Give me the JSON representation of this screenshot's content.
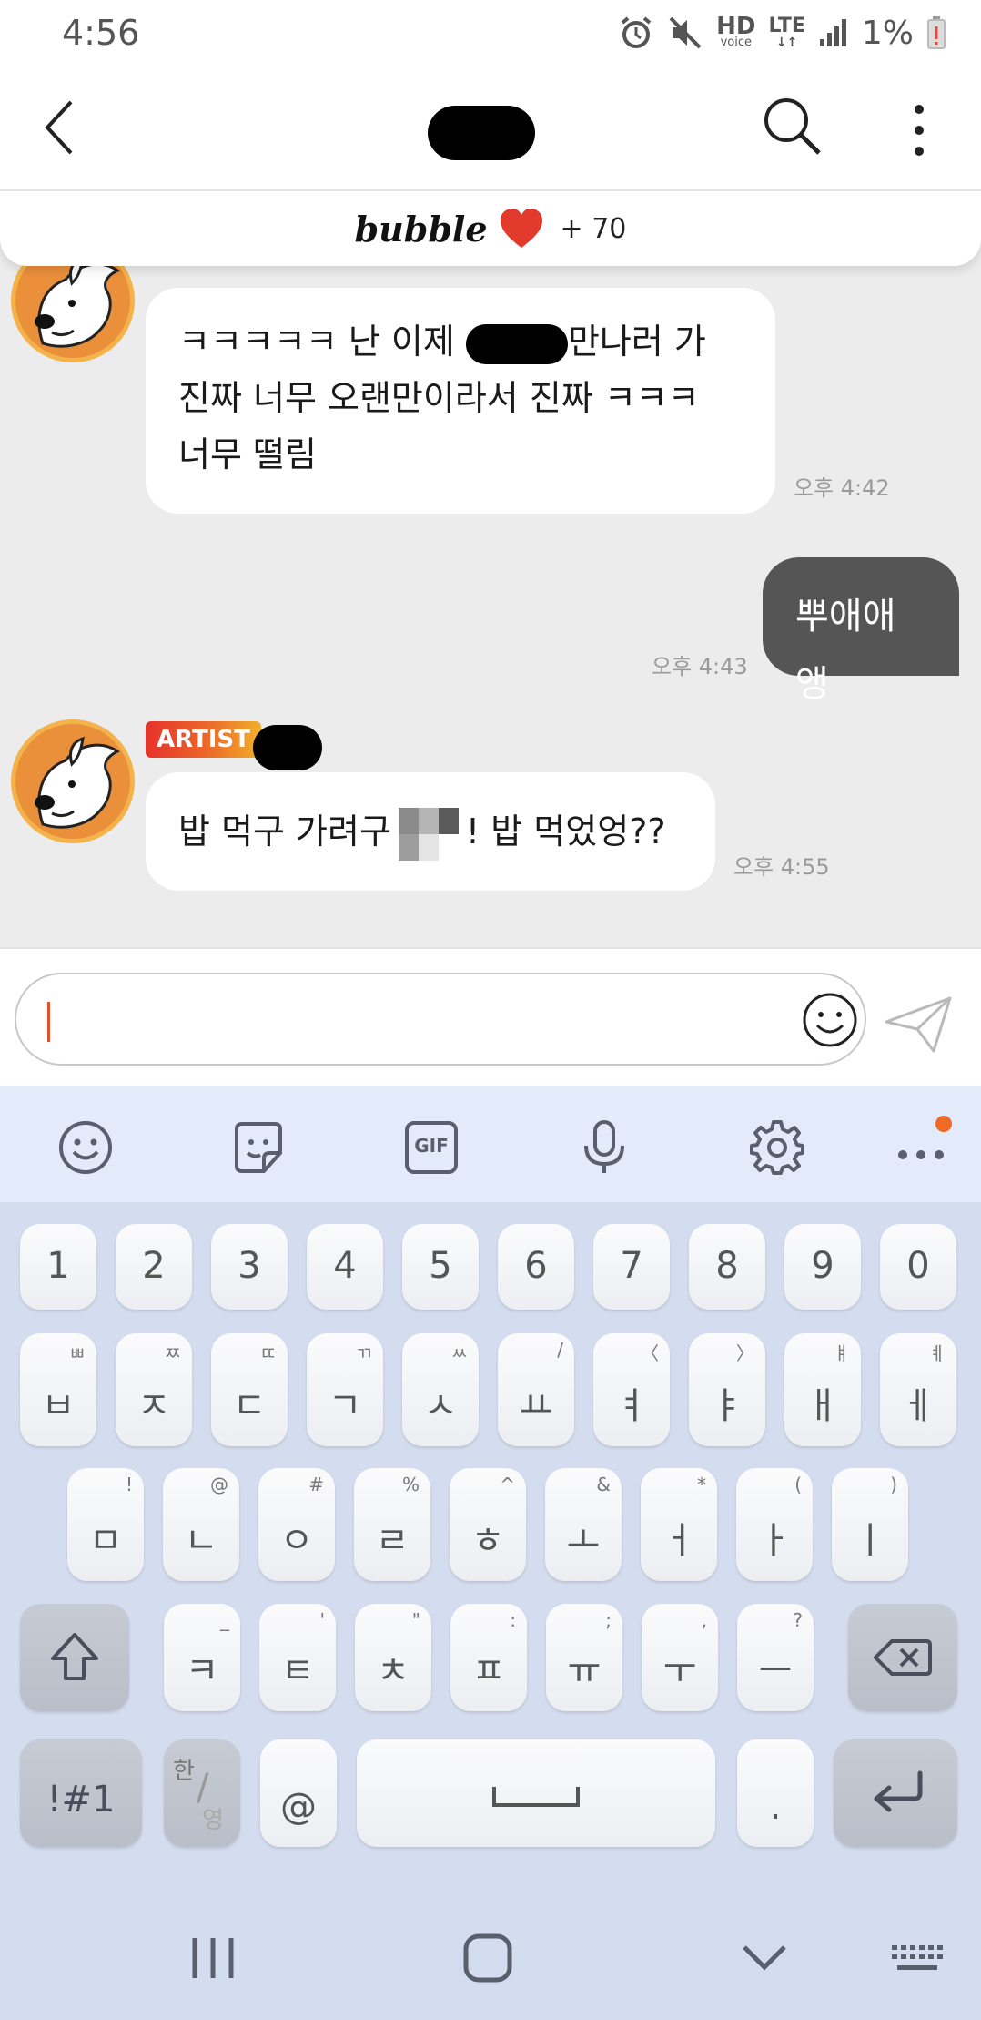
{
  "status_bar": {
    "time": "4:56",
    "hd_label": "HD",
    "hd_sub": "voice",
    "lte_label": "LTE",
    "battery": "1%"
  },
  "header": {
    "back_icon": "chevron-left-icon",
    "search_icon": "search-icon",
    "more_icon": "more-vertical-icon"
  },
  "banner": {
    "logo": "bubble",
    "heart_color": "#e23a2c",
    "plus": "+ 70"
  },
  "messages": [
    {
      "sender": "artist",
      "lines": [
        "ㅋㅋㅋㅋㅋ 난 이제",
        "만나러 가",
        "진짜 너무 오랜만이라서 진짜 ㅋㅋㅋ",
        "너무 떨림"
      ],
      "time": "오후 4:42"
    },
    {
      "sender": "me",
      "text": "뿌애애앵",
      "time": "오후 4:43"
    },
    {
      "sender": "artist",
      "badge": "ARTIST",
      "text_before": "밥 먹구 가려구",
      "text_after": "! 밥 먹었엉??",
      "time": "오후 4:55"
    }
  ],
  "input": {
    "value": "",
    "emoji_icon": "smiley-icon",
    "send_icon": "paper-plane-icon"
  },
  "keyboard_toolbar": [
    "smiley-icon",
    "sticker-icon",
    "gif-icon",
    "microphone-icon",
    "gear-icon",
    "more-horizontal-icon"
  ],
  "keyboard": {
    "gif_label": "GIF",
    "numbers": [
      "1",
      "2",
      "3",
      "4",
      "5",
      "6",
      "7",
      "8",
      "9",
      "0"
    ],
    "row1": [
      {
        "main": "ㅂ",
        "hint": "ㅃ"
      },
      {
        "main": "ㅈ",
        "hint": "ㅉ"
      },
      {
        "main": "ㄷ",
        "hint": "ㄸ"
      },
      {
        "main": "ㄱ",
        "hint": "ㄲ"
      },
      {
        "main": "ㅅ",
        "hint": "ㅆ"
      },
      {
        "main": "ㅛ",
        "hint": "/"
      },
      {
        "main": "ㅕ",
        "hint": "〈"
      },
      {
        "main": "ㅑ",
        "hint": "〉"
      },
      {
        "main": "ㅐ",
        "hint": "ㅒ"
      },
      {
        "main": "ㅔ",
        "hint": "ㅖ"
      }
    ],
    "row2": [
      {
        "main": "ㅁ",
        "hint": "!"
      },
      {
        "main": "ㄴ",
        "hint": "@"
      },
      {
        "main": "ㅇ",
        "hint": "#"
      },
      {
        "main": "ㄹ",
        "hint": "%"
      },
      {
        "main": "ㅎ",
        "hint": "^"
      },
      {
        "main": "ㅗ",
        "hint": "&"
      },
      {
        "main": "ㅓ",
        "hint": "*"
      },
      {
        "main": "ㅏ",
        "hint": "("
      },
      {
        "main": "ㅣ",
        "hint": ")"
      }
    ],
    "row3": [
      {
        "main": "ㅋ",
        "hint": "_"
      },
      {
        "main": "ㅌ",
        "hint": "'"
      },
      {
        "main": "ㅊ",
        "hint": "\""
      },
      {
        "main": "ㅍ",
        "hint": ":"
      },
      {
        "main": "ㅠ",
        "hint": ";"
      },
      {
        "main": "ㅜ",
        "hint": ","
      },
      {
        "main": "ㅡ",
        "hint": "?"
      }
    ],
    "symbols_label": "!#1",
    "lang_top": "한",
    "lang_bottom": "영",
    "at_label": "@",
    "period_label": "."
  },
  "navbar": [
    "recent-apps-icon",
    "home-icon",
    "hide-keyboard-icon",
    "keyboard-icon"
  ]
}
